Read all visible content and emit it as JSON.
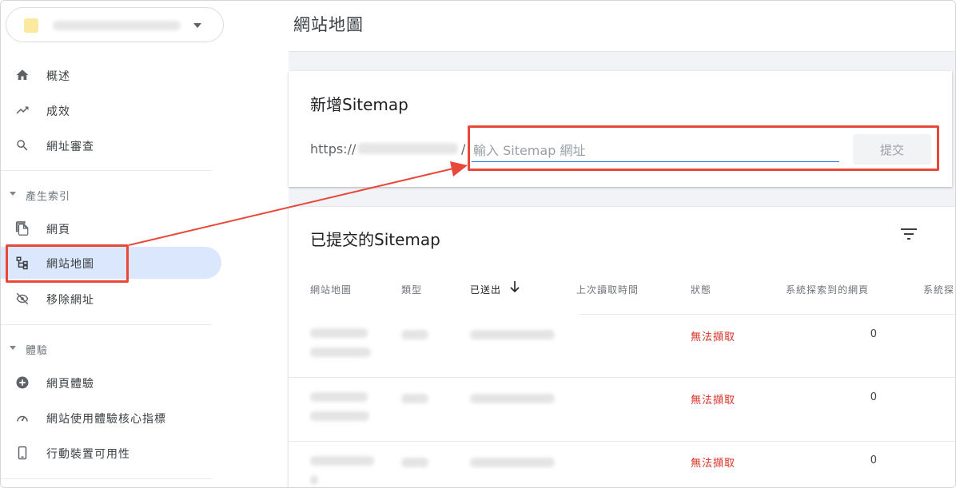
{
  "sidebar": {
    "property_selector": {
      "label": ""
    },
    "items_top": [
      {
        "label": "概述",
        "icon": "home-icon"
      },
      {
        "label": "成效",
        "icon": "trending-up-icon"
      },
      {
        "label": "網址審查",
        "icon": "search-icon"
      }
    ],
    "section_index": {
      "label": "產生索引",
      "items": [
        {
          "label": "網頁",
          "icon": "pages-icon"
        },
        {
          "label": "網站地圖",
          "icon": "sitemap-icon",
          "active": true
        },
        {
          "label": "移除網址",
          "icon": "eye-off-icon"
        }
      ]
    },
    "section_experience": {
      "label": "體驗",
      "items": [
        {
          "label": "網頁體驗",
          "icon": "page-experience-icon"
        },
        {
          "label": "網站使用體驗核心指標",
          "icon": "gauge-icon"
        },
        {
          "label": "行動裝置可用性",
          "icon": "mobile-icon"
        }
      ]
    }
  },
  "header": {
    "title": "網站地圖"
  },
  "add_sitemap": {
    "title": "新增Sitemap",
    "url_prefix": "https://",
    "slash": "/",
    "input_placeholder": "輸入 Sitemap 網址",
    "submit_label": "提交"
  },
  "submitted": {
    "title": "已提交的Sitemap",
    "columns": [
      "網站地圖",
      "類型",
      "已送出",
      "上次讀取時間",
      "狀態",
      "系統探索到的網頁",
      "系統探"
    ],
    "rows": [
      {
        "status": "無法擷取",
        "discovered_pages": "0"
      },
      {
        "status": "無法擷取",
        "discovered_pages": "0"
      },
      {
        "status": "無法擷取",
        "discovered_pages": "0"
      }
    ]
  },
  "colors": {
    "accent": "#1a73e8",
    "active_bg": "#dbe7fc",
    "error": "#d93025",
    "highlight": "#e8473a"
  }
}
